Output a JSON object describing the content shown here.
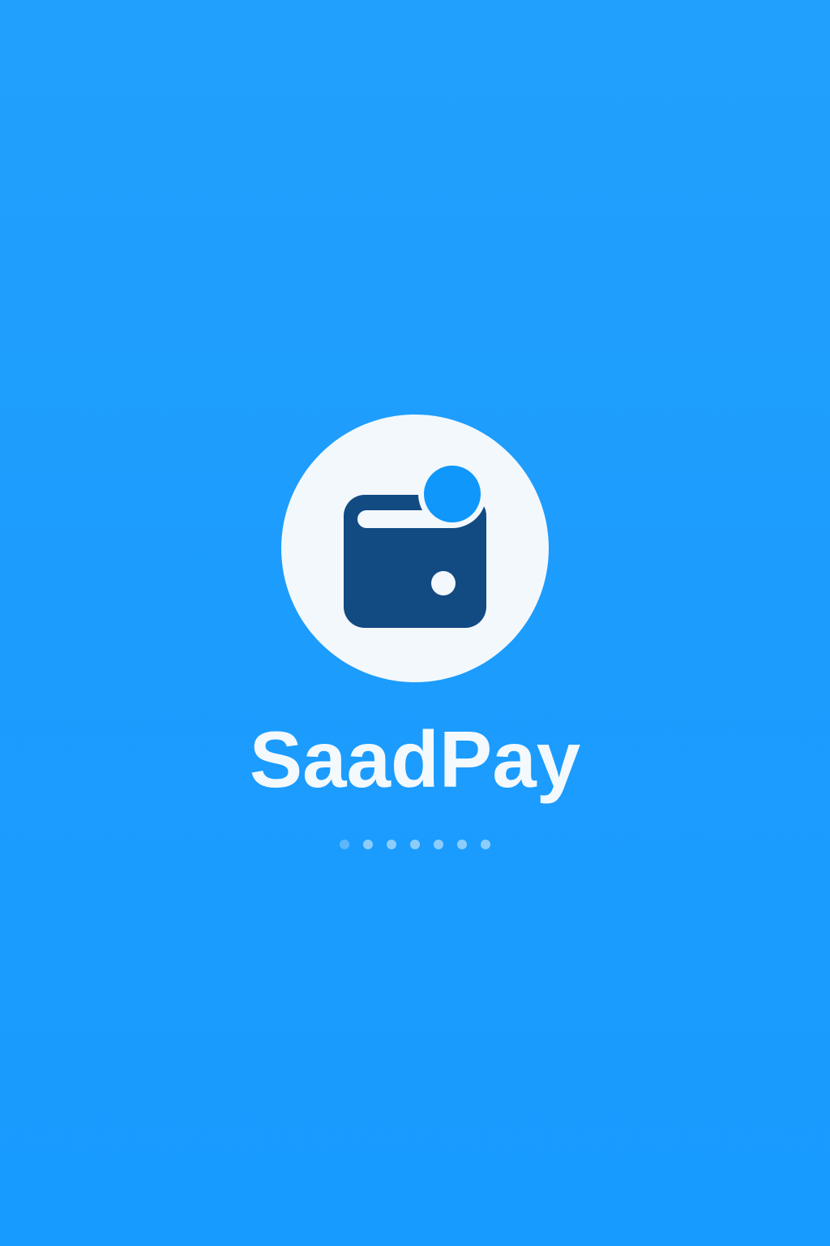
{
  "app": {
    "name": "SaadPay"
  },
  "logo": {
    "icon": "wallet-icon",
    "badge_icon": "coin-icon",
    "circle_color": "#f3f8fc",
    "wallet_color": "#124a82",
    "coin_color": "#0f97fb"
  },
  "theme": {
    "background": "#1e9dfd",
    "text_color": "#f4f9fd"
  },
  "loader": {
    "dot_count": 7,
    "active_dots": [
      false,
      true,
      true,
      true,
      true,
      true,
      true
    ]
  }
}
